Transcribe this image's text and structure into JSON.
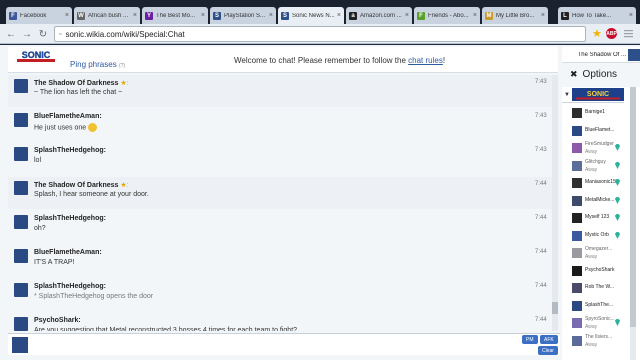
{
  "browser": {
    "tabs": [
      {
        "label": "Facebook",
        "favicon": "F",
        "color": "#3b5998"
      },
      {
        "label": "African bush ...",
        "favicon": "W",
        "color": "#666666"
      },
      {
        "label": "The Best Mo...",
        "favicon": "Y",
        "color": "#6b1fa3"
      },
      {
        "label": "PlayStation S...",
        "favicon": "S",
        "color": "#2d4f8a"
      },
      {
        "label": "Sonic News N...",
        "favicon": "S",
        "color": "#2d4f8a",
        "active": true
      },
      {
        "label": "Amazon.com ...",
        "favicon": "a",
        "color": "#222222"
      },
      {
        "label": "Friends - Abo...",
        "favicon": "F",
        "color": "#5aa02c"
      },
      {
        "label": "My Little Bro...",
        "favicon": "M",
        "color": "#c79a2b"
      },
      {
        "label": "How To Take...",
        "favicon": "L",
        "color": "#222222"
      }
    ],
    "url": "sonic.wikia.com/wiki/Special:Chat"
  },
  "header": {
    "logo_text": "SONIC",
    "ping_phrases": "Ping phrases",
    "ping_count": "(?)",
    "welcome": "Welcome to chat! Please remember to follow the ",
    "rules_link": "chat rules",
    "welcome_end": "!"
  },
  "current_user": "The Shadow Of ...",
  "options_label": "Options",
  "messages": [
    {
      "name": "The Shadow Of Darkness",
      "star": true,
      "text": "~ The lion has left the chat ~",
      "time": "7:43",
      "inline": true,
      "action": false
    },
    {
      "name": "BlueFlametheAman:",
      "star": false,
      "text": "He just uses one",
      "emoji": true,
      "time": "7:43",
      "inline": false,
      "action": false
    },
    {
      "name": "SplashTheHedgehog:",
      "star": false,
      "text": "lol",
      "time": "7:43",
      "inline": false,
      "action": false
    },
    {
      "name": "The Shadow Of Darkness",
      "star": true,
      "text": "Splash, I hear someone at your door.",
      "time": "7:44",
      "inline": true,
      "action": false
    },
    {
      "name": "SplashTheHedgehog:",
      "star": false,
      "text": "oh?",
      "time": "7:44",
      "inline": false,
      "action": false
    },
    {
      "name": "BlueFlametheAman:",
      "star": false,
      "text": "IT'S A TRAP!",
      "time": "7:44",
      "inline": false,
      "action": false
    },
    {
      "name": "SplashTheHedgehog:",
      "star": false,
      "text": "* SplashTheHedgehog opens the door",
      "time": "7:44",
      "inline": false,
      "action": true
    },
    {
      "name": "PsychoShark:",
      "star": false,
      "text": "Are you suggesting that Metal reconstructed 3 bosses 4 times for each team to fight?",
      "time": "7:44",
      "inline": false,
      "action": false
    }
  ],
  "users": [
    {
      "name": "Barnige1",
      "away": false,
      "gem": false
    },
    {
      "name": "BlueFlamet...",
      "away": false,
      "gem": false
    },
    {
      "name": "FireSmudger",
      "away": true,
      "gem": true
    },
    {
      "name": "Glitchguy",
      "away": true,
      "gem": true
    },
    {
      "name": "Maniasonic15",
      "away": false,
      "gem": true
    },
    {
      "name": "MetalMicke...",
      "away": false,
      "gem": true
    },
    {
      "name": "Myself 123",
      "away": false,
      "gem": true
    },
    {
      "name": "Mystic Orb",
      "away": false,
      "gem": true
    },
    {
      "name": "Omegazer...",
      "away": true,
      "gem": false
    },
    {
      "name": "PsychoShark",
      "away": false,
      "gem": false
    },
    {
      "name": "Rob The W...",
      "away": false,
      "gem": false
    },
    {
      "name": "SplashThe...",
      "away": false,
      "gem": false
    },
    {
      "name": "SpyroSonic...",
      "away": true,
      "gem": true
    },
    {
      "name": "The Ilsiers...",
      "away": true,
      "gem": false
    }
  ],
  "away_label": "Away",
  "input": {
    "placeholder": ""
  },
  "buttons": {
    "pm": "PM",
    "afk": "AFK",
    "clear": "Clear"
  },
  "colors": {
    "accent": "#3b6fc4",
    "link": "#2c5aa0",
    "gem": "#2bb39a",
    "star": "#e6a800"
  }
}
